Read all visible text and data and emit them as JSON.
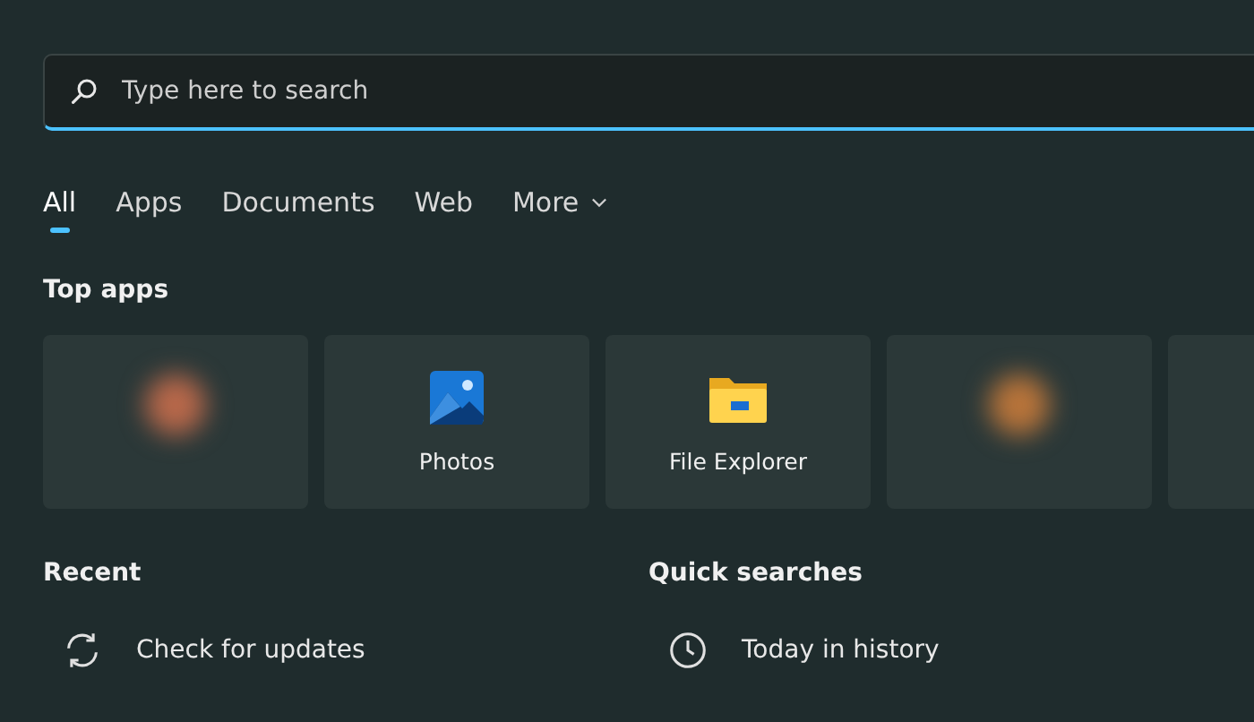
{
  "search": {
    "placeholder": "Type here to search"
  },
  "tabs": [
    {
      "label": "All",
      "selected": true
    },
    {
      "label": "Apps",
      "selected": false
    },
    {
      "label": "Documents",
      "selected": false
    },
    {
      "label": "Web",
      "selected": false
    },
    {
      "label": "More",
      "selected": false,
      "kind": "menu"
    }
  ],
  "top_apps": {
    "title": "Top apps",
    "items": [
      {
        "kind": "blurred",
        "color": "#b8684a"
      },
      {
        "kind": "photos",
        "label": "Photos"
      },
      {
        "kind": "folder",
        "label": "File Explorer"
      },
      {
        "kind": "blurred",
        "color": "#b8743a"
      },
      {
        "kind": "empty"
      }
    ]
  },
  "recent": {
    "title": "Recent",
    "items": [
      {
        "kind": "update",
        "label": "Check for updates"
      }
    ]
  },
  "quick_searches": {
    "title": "Quick searches",
    "items": [
      {
        "kind": "clock",
        "label": "Today in history"
      }
    ]
  }
}
